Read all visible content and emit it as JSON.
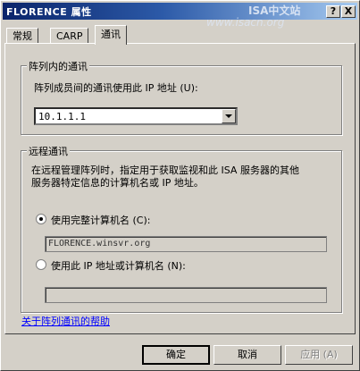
{
  "window": {
    "title": "FLORENCE 属性",
    "watermark_line1": "ISA中文站",
    "watermark_line2": "www.isacn.org",
    "help_button": "?",
    "close_button": "X"
  },
  "tabs": [
    {
      "label": "常规"
    },
    {
      "label": "CARP"
    },
    {
      "label": "通讯",
      "active": true
    }
  ],
  "array_comm": {
    "group_title": "阵列内的通讯",
    "label": "阵列成员间的通讯使用此 IP 地址 (U):",
    "selected_ip": "10.1.1.1"
  },
  "remote_comm": {
    "group_title": "远程通讯",
    "description_line1": "在远程管理阵列时，指定用于获取监视和此 ISA 服务器的其他",
    "description_line2": "服务器特定信息的计算机名或 IP 地址。",
    "option_fqdn_label": "使用完整计算机名 (C):",
    "option_fqdn_selected": true,
    "fqdn_value": "FLORENCE.winsvr.org",
    "option_ip_label": "使用此 IP 地址或计算机名 (N):",
    "option_ip_selected": false,
    "ip_value": ""
  },
  "help_link": "关于阵列通讯的帮助",
  "buttons": {
    "ok": "确定",
    "cancel": "取消",
    "apply": "应用 (A)"
  }
}
